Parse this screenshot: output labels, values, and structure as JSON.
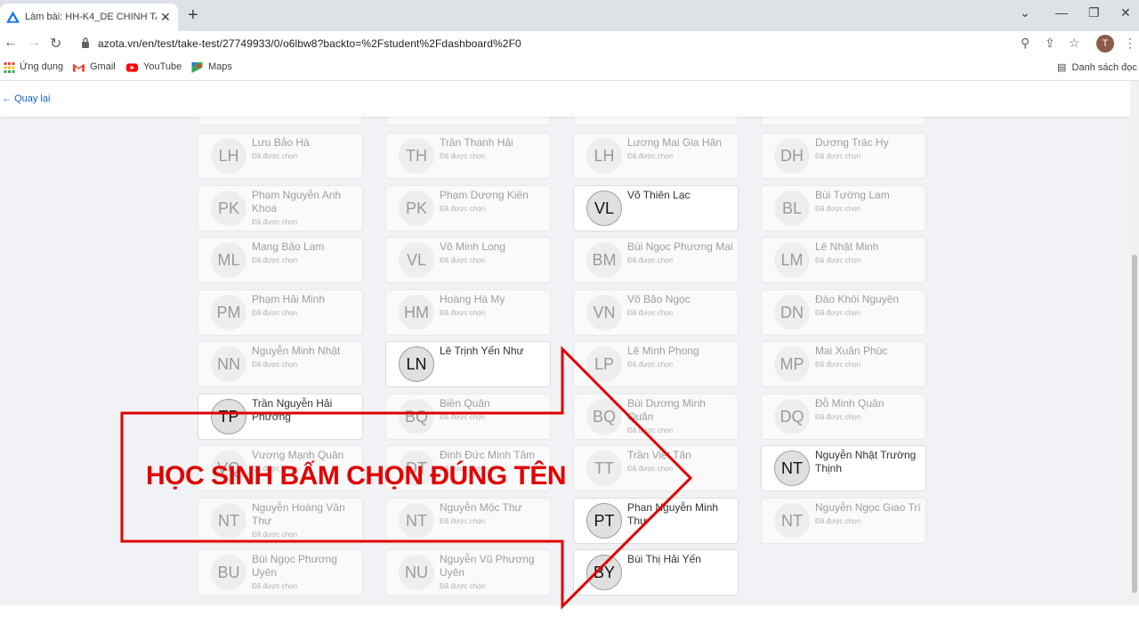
{
  "browser": {
    "tab_title": "Làm bài: HH-K4_DE CHINH TA_GIUA",
    "url": "azota.vn/en/test/take-test/27749933/0/o6lbw8?backto=%2Fstudent%2Fdashboard%2F0",
    "avatar_letter": "T",
    "bookmarks": [
      "Ứng dụng",
      "Gmail",
      "YouTube",
      "Maps"
    ],
    "reading_list": "Danh sách đọc"
  },
  "page": {
    "back_label": "Quay lại",
    "callout": "HỌC SINH BẤM CHỌN ĐÚNG TÊN"
  },
  "students": [
    {
      "initials": "LH",
      "name": "Lưu Bảo Hà",
      "status": "Đã được chọn"
    },
    {
      "initials": "TH",
      "name": "Trần Thanh Hải",
      "status": "Đã được chọn"
    },
    {
      "initials": "LH",
      "name": "Lương Mai Gia Hân",
      "status": "Đã được chọn"
    },
    {
      "initials": "DH",
      "name": "Dương Trác Hy",
      "status": "Đã được chọn"
    },
    {
      "initials": "PK",
      "name": "Phạm Nguyễn Anh Khoa",
      "status": "Đã được chọn"
    },
    {
      "initials": "PK",
      "name": "Phạm Dương Kiên",
      "status": "Đã được chọn"
    },
    {
      "initials": "VL",
      "name": "Võ Thiên Lạc",
      "status": ""
    },
    {
      "initials": "BL",
      "name": "Bùi Tường Lam",
      "status": "Đã được chọn"
    },
    {
      "initials": "ML",
      "name": "Mang Bảo Lam",
      "status": "Đã được chọn"
    },
    {
      "initials": "VL",
      "name": "Võ Minh Long",
      "status": "Đã được chọn"
    },
    {
      "initials": "BM",
      "name": "Bùi Ngọc Phương Mai",
      "status": "Đã được chọn"
    },
    {
      "initials": "LM",
      "name": "Lê Nhật Minh",
      "status": "Đã được chọn"
    },
    {
      "initials": "PM",
      "name": "Phạm Hải Minh",
      "status": "Đã được chọn"
    },
    {
      "initials": "HM",
      "name": "Hoàng Hà My",
      "status": "Đã được chọn"
    },
    {
      "initials": "VN",
      "name": "Võ Bảo Ngọc",
      "status": "Đã được chọn"
    },
    {
      "initials": "DN",
      "name": "Đào Khôi Nguyên",
      "status": "Đã được chọn"
    },
    {
      "initials": "NN",
      "name": "Nguyễn Minh Nhật",
      "status": "Đã được chọn"
    },
    {
      "initials": "LN",
      "name": "Lê Trịnh Yến Như",
      "status": ""
    },
    {
      "initials": "LP",
      "name": "Lê Minh Phong",
      "status": "Đã được chọn"
    },
    {
      "initials": "MP",
      "name": "Mai Xuân Phúc",
      "status": "Đã được chọn"
    },
    {
      "initials": "TP",
      "name": "Trần Nguyễn Hải Phương",
      "status": ""
    },
    {
      "initials": "BQ",
      "name": "Biền Quân",
      "status": "Đã được chọn"
    },
    {
      "initials": "BQ",
      "name": "Bùi Dương Minh Quân",
      "status": "Đã được chọn"
    },
    {
      "initials": "DQ",
      "name": "Đỗ Minh Quân",
      "status": "Đã được chọn"
    },
    {
      "initials": "VQ",
      "name": "Vương Mạnh Quân",
      "status": "Đã được chọn"
    },
    {
      "initials": "DT",
      "name": "Đinh Đức Minh Tâm",
      "status": "Đã được chọn"
    },
    {
      "initials": "TT",
      "name": "Trần Việt Tân",
      "status": "Đã được chọn"
    },
    {
      "initials": "NT",
      "name": "Nguyễn Nhật Trường Thịnh",
      "status": ""
    },
    {
      "initials": "NT",
      "name": "Nguyễn Hoàng Vân Thư",
      "status": "Đã được chọn"
    },
    {
      "initials": "NT",
      "name": "Nguyễn Mộc Thư",
      "status": "Đã được chọn"
    },
    {
      "initials": "PT",
      "name": "Phan Nguyễn Minh Thư",
      "status": ""
    },
    {
      "initials": "NT",
      "name": "Nguyễn Ngọc Giao Trí",
      "status": "Đã được chọn"
    },
    {
      "initials": "BU",
      "name": "Bùi Ngọc Phương Uyên",
      "status": "Đã được chọn"
    },
    {
      "initials": "NU",
      "name": "Nguyễn Vũ Phương Uyên",
      "status": "Đã được chọn"
    },
    {
      "initials": "BY",
      "name": "Bùi Thị Hải Yến",
      "status": ""
    }
  ]
}
